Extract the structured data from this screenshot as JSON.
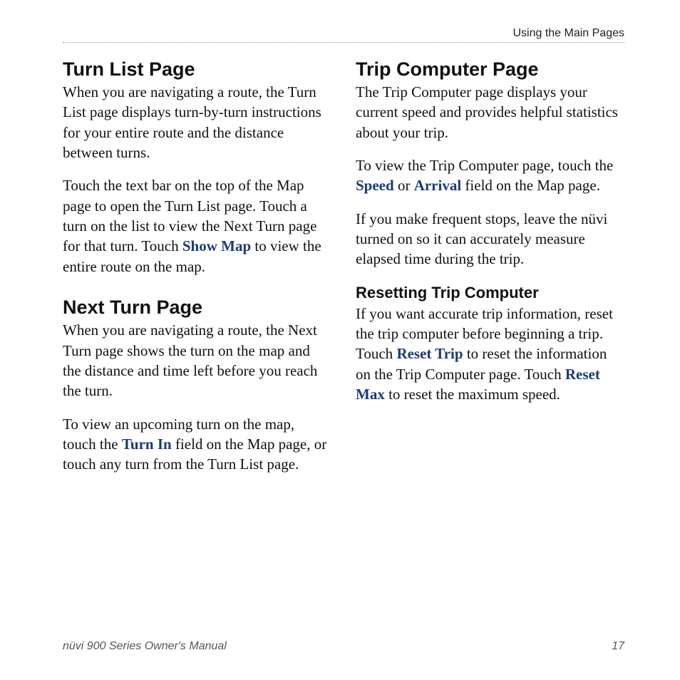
{
  "running_head": "Using the Main Pages",
  "left": {
    "h1": "Turn List Page",
    "p1": "When you are navigating a route, the Turn List page displays turn-by-turn instructions for your entire route and the distance between turns.",
    "p2a": "Touch the text bar on the top of the Map page to open the Turn List page. Touch a turn on the list to view the Next Turn page for that turn. Touch ",
    "p2b_bold": "Show Map",
    "p2c": " to view the entire route on the map.",
    "h2": "Next Turn Page",
    "p3": "When you are navigating a route, the Next Turn page shows the turn on the map and the distance and time left before you reach the turn.",
    "p4a": "To view an upcoming turn on the map, touch the ",
    "p4b_bold": "Turn In",
    "p4c": " field on the Map page, or touch any turn from the Turn List page."
  },
  "right": {
    "h1": "Trip Computer Page",
    "p1": "The Trip Computer page displays your current speed and provides helpful statistics about your trip.",
    "p2a": "To view the Trip Computer page, touch the ",
    "p2b_bold": "Speed",
    "p2c": " or ",
    "p2d_bold": "Arrival",
    "p2e": " field on the Map page.",
    "p3": "If you make frequent stops, leave the nüvi turned on so it can accurately measure elapsed time during the trip.",
    "h2": "Resetting Trip Computer",
    "p4a": "If you want accurate trip information, reset the trip computer before beginning a trip. Touch ",
    "p4b_bold": "Reset Trip",
    "p4c": " to reset the information on the Trip Computer page. Touch ",
    "p4d_bold": "Reset Max",
    "p4e": " to reset the maximum speed."
  },
  "footer": {
    "title": "nüvi 900 Series Owner's Manual",
    "page": "17"
  }
}
